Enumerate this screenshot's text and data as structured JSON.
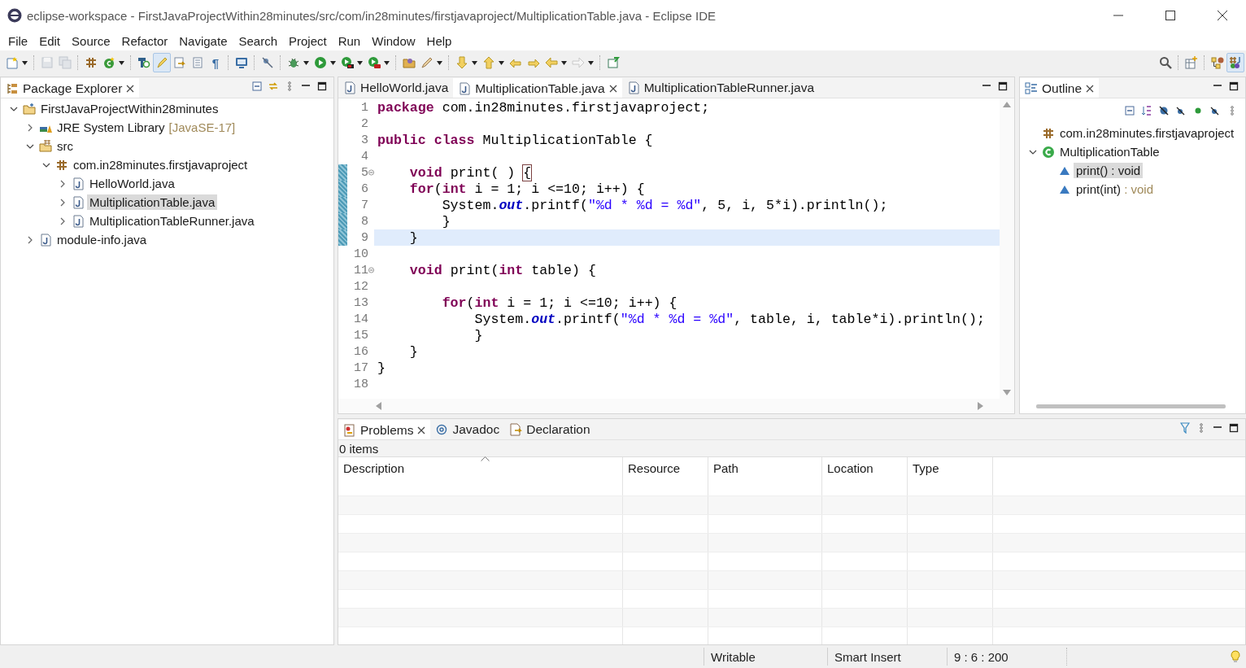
{
  "window": {
    "title": "eclipse-workspace - FirstJavaProjectWithin28minutes/src/com/in28minutes/firstjavaproject/MultiplicationTable.java - Eclipse IDE"
  },
  "menu": [
    "File",
    "Edit",
    "Source",
    "Refactor",
    "Navigate",
    "Search",
    "Project",
    "Run",
    "Window",
    "Help"
  ],
  "toolbar": [
    {
      "kind": "new-file",
      "dropdown": true,
      "pressed": false,
      "disabled": false
    },
    {
      "kind": "separator"
    },
    {
      "kind": "save",
      "dropdown": false,
      "pressed": false,
      "disabled": true
    },
    {
      "kind": "save-all",
      "dropdown": false,
      "pressed": false,
      "disabled": true
    },
    {
      "kind": "separator"
    },
    {
      "kind": "package",
      "dropdown": false,
      "pressed": false,
      "disabled": false
    },
    {
      "kind": "new-class",
      "dropdown": true,
      "pressed": false,
      "disabled": false
    },
    {
      "kind": "separator"
    },
    {
      "kind": "open-type",
      "dropdown": false,
      "pressed": false,
      "disabled": false
    },
    {
      "kind": "highlighter",
      "dropdown": false,
      "pressed": true,
      "disabled": false
    },
    {
      "kind": "document-arrow",
      "dropdown": false,
      "pressed": false,
      "disabled": false
    },
    {
      "kind": "document",
      "dropdown": false,
      "pressed": false,
      "disabled": false
    },
    {
      "kind": "glyph",
      "glyph": "¶",
      "dropdown": false,
      "pressed": false,
      "disabled": false
    },
    {
      "kind": "separator"
    },
    {
      "kind": "monitor",
      "dropdown": false,
      "pressed": false,
      "disabled": false
    },
    {
      "kind": "separator"
    },
    {
      "kind": "breakpoint",
      "dropdown": false,
      "pressed": false,
      "disabled": false
    },
    {
      "kind": "separator"
    },
    {
      "kind": "bug",
      "dropdown": true,
      "pressed": false,
      "disabled": false
    },
    {
      "kind": "run",
      "dropdown": true,
      "pressed": false,
      "disabled": false
    },
    {
      "kind": "coverage",
      "dropdown": true,
      "pressed": false,
      "disabled": false
    },
    {
      "kind": "tools",
      "dropdown": true,
      "pressed": false,
      "disabled": false
    },
    {
      "kind": "separator"
    },
    {
      "kind": "folder",
      "dropdown": false,
      "pressed": false,
      "disabled": false
    },
    {
      "kind": "pen",
      "dropdown": true,
      "pressed": false,
      "disabled": false
    },
    {
      "kind": "separator"
    },
    {
      "kind": "arrow-down",
      "dropdown": true,
      "pressed": false,
      "disabled": false
    },
    {
      "kind": "arrow-up",
      "dropdown": true,
      "pressed": false,
      "disabled": false
    },
    {
      "kind": "edit-back",
      "dropdown": false,
      "pressed": false,
      "disabled": false
    },
    {
      "kind": "edit-forward",
      "dropdown": false,
      "pressed": false,
      "disabled": false
    },
    {
      "kind": "arrow-left",
      "dropdown": true,
      "pressed": false,
      "disabled": false
    },
    {
      "kind": "arrow-right",
      "dropdown": true,
      "pressed": false,
      "disabled": true
    },
    {
      "kind": "separator"
    },
    {
      "kind": "pin",
      "dropdown": false,
      "pressed": false,
      "disabled": false
    }
  ],
  "toolbar_right": [
    {
      "kind": "search",
      "dropdown": false,
      "pressed": false,
      "disabled": false
    },
    {
      "kind": "separator"
    },
    {
      "kind": "open-perspective",
      "dropdown": false,
      "pressed": false,
      "disabled": false
    },
    {
      "kind": "separator"
    },
    {
      "kind": "hierarchy",
      "dropdown": false,
      "pressed": false,
      "disabled": false
    },
    {
      "kind": "java-perspective",
      "dropdown": false,
      "pressed": true,
      "disabled": false
    }
  ],
  "package_explorer": {
    "title": "Package Explorer",
    "tree": [
      {
        "kind": "project",
        "label": "FirstJavaProjectWithin28minutes",
        "expanded": true,
        "selected": false,
        "children": [
          {
            "kind": "library",
            "label": "JRE System Library",
            "decoration": "[JavaSE-17]",
            "expanded": false,
            "selected": false
          },
          {
            "kind": "folder",
            "label": "src",
            "expanded": true,
            "selected": false,
            "children": [
              {
                "kind": "package",
                "label": "com.in28minutes.firstjavaproject",
                "expanded": true,
                "selected": false,
                "children": [
                  {
                    "kind": "java-file",
                    "label": "HelloWorld.java",
                    "expanded": false,
                    "selected": false
                  },
                  {
                    "kind": "java-file",
                    "label": "MultiplicationTable.java",
                    "expanded": false,
                    "selected": true
                  },
                  {
                    "kind": "java-file",
                    "label": "MultiplicationTableRunner.java",
                    "expanded": false,
                    "selected": false
                  }
                ]
              }
            ]
          },
          {
            "kind": "java-file",
            "label": "module-info.java",
            "expanded": false,
            "selected": false
          }
        ]
      }
    ]
  },
  "editor": {
    "tabs": [
      {
        "label": "HelloWorld.java",
        "selected": false
      },
      {
        "label": "MultiplicationTable.java",
        "selected": true
      },
      {
        "label": "MultiplicationTableRunner.java",
        "selected": false
      }
    ],
    "lines": [
      {
        "number": "1",
        "fold_marker": false,
        "changed": false,
        "current": false,
        "tokens": [
          {
            "kind": "keyword",
            "text": "package"
          },
          {
            "kind": "plain",
            "text": " com.in28minutes.firstjavaproject;"
          }
        ]
      },
      {
        "number": "2",
        "fold_marker": false,
        "changed": false,
        "current": false
      },
      {
        "number": "3",
        "fold_marker": false,
        "changed": false,
        "current": false,
        "tokens": [
          {
            "kind": "keyword",
            "text": "public class"
          },
          {
            "kind": "plain",
            "text": " MultiplicationTable {"
          }
        ]
      },
      {
        "number": "4",
        "fold_marker": false,
        "changed": false,
        "current": false
      },
      {
        "number": "5",
        "fold_marker": true,
        "changed": true,
        "current": false,
        "tokens": [
          {
            "kind": "keyword",
            "text": "    void"
          },
          {
            "kind": "plain",
            "text": " print( ) "
          },
          {
            "kind": "bracket",
            "text": "{"
          }
        ]
      },
      {
        "number": "6",
        "fold_marker": false,
        "changed": true,
        "current": false,
        "tokens": [
          {
            "kind": "keyword",
            "text": "    for"
          },
          {
            "kind": "plain",
            "text": "("
          },
          {
            "kind": "keyword",
            "text": "int"
          },
          {
            "kind": "plain",
            "text": " i = 1; i <=10; i++) {"
          }
        ]
      },
      {
        "number": "7",
        "fold_marker": false,
        "changed": true,
        "current": false,
        "tokens": [
          {
            "kind": "plain",
            "text": "        System."
          },
          {
            "kind": "field",
            "text": "out"
          },
          {
            "kind": "plain",
            "text": ".printf("
          },
          {
            "kind": "string",
            "text": "\"%d * %d = %d\""
          },
          {
            "kind": "plain",
            "text": ", 5, i, 5*i).println();"
          }
        ]
      },
      {
        "number": "8",
        "fold_marker": false,
        "changed": true,
        "current": false,
        "tokens": [
          {
            "kind": "plain",
            "text": "        }"
          }
        ]
      },
      {
        "number": "9",
        "fold_marker": false,
        "changed": true,
        "current": true,
        "tokens": [
          {
            "kind": "plain",
            "text": "    }"
          }
        ]
      },
      {
        "number": "10",
        "fold_marker": false,
        "changed": false,
        "current": false
      },
      {
        "number": "11",
        "fold_marker": true,
        "changed": false,
        "current": false,
        "tokens": [
          {
            "kind": "keyword",
            "text": "    void"
          },
          {
            "kind": "plain",
            "text": " print("
          },
          {
            "kind": "keyword",
            "text": "int"
          },
          {
            "kind": "plain",
            "text": " table) {"
          }
        ]
      },
      {
        "number": "12",
        "fold_marker": false,
        "changed": false,
        "current": false
      },
      {
        "number": "13",
        "fold_marker": false,
        "changed": false,
        "current": false,
        "tokens": [
          {
            "kind": "keyword",
            "text": "        for"
          },
          {
            "kind": "plain",
            "text": "("
          },
          {
            "kind": "keyword",
            "text": "int"
          },
          {
            "kind": "plain",
            "text": " i = 1; i <=10; i++) {"
          }
        ]
      },
      {
        "number": "14",
        "fold_marker": false,
        "changed": false,
        "current": false,
        "tokens": [
          {
            "kind": "plain",
            "text": "            System."
          },
          {
            "kind": "field",
            "text": "out"
          },
          {
            "kind": "plain",
            "text": ".printf("
          },
          {
            "kind": "string",
            "text": "\"%d * %d = %d\""
          },
          {
            "kind": "plain",
            "text": ", table, i, table*i).println();"
          }
        ]
      },
      {
        "number": "15",
        "fold_marker": false,
        "changed": false,
        "current": false,
        "tokens": [
          {
            "kind": "plain",
            "text": "            }"
          }
        ]
      },
      {
        "number": "16",
        "fold_marker": false,
        "changed": false,
        "current": false,
        "tokens": [
          {
            "kind": "plain",
            "text": "    }"
          }
        ]
      },
      {
        "number": "17",
        "fold_marker": false,
        "changed": false,
        "current": false,
        "tokens": [
          {
            "kind": "plain",
            "text": "}"
          }
        ]
      },
      {
        "number": "18",
        "fold_marker": false,
        "changed": false,
        "current": false
      }
    ]
  },
  "outline": {
    "title": "Outline",
    "tree": [
      {
        "kind": "package",
        "label": "com.in28minutes.firstjavaproject",
        "selected": false
      },
      {
        "kind": "class",
        "label": "MultiplicationTable",
        "expanded": true,
        "selected": false,
        "children": [
          {
            "kind": "method",
            "label": "print()",
            "decoration": " : void",
            "selected": true
          },
          {
            "kind": "method",
            "label": "print(int)",
            "decoration": " : void",
            "selected": false
          }
        ]
      }
    ]
  },
  "bottom": {
    "tabs": [
      {
        "kind": "problems",
        "label": "Problems",
        "selected": true
      },
      {
        "kind": "javadoc",
        "label": "Javadoc",
        "selected": false
      },
      {
        "kind": "declaration",
        "label": "Declaration",
        "selected": false
      }
    ],
    "summary": "0 items",
    "columns": [
      {
        "label": "Description",
        "sorted": true
      },
      {
        "label": "Resource",
        "sorted": false
      },
      {
        "label": "Path",
        "sorted": false
      },
      {
        "label": "Location",
        "sorted": false
      },
      {
        "label": "Type",
        "sorted": false
      }
    ]
  },
  "status_bar": {
    "fields": [
      "Writable",
      "Smart Insert",
      "9 : 6 : 200"
    ]
  }
}
